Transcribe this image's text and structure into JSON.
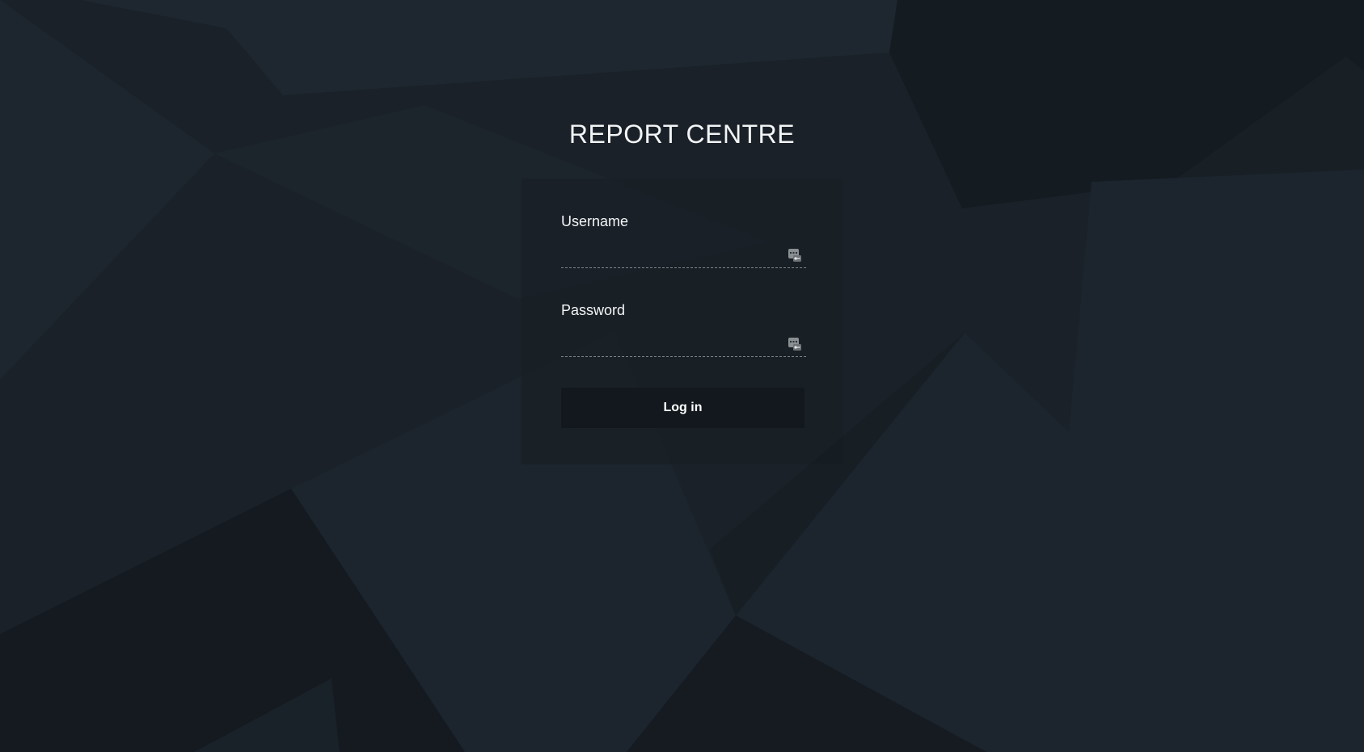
{
  "page": {
    "title": "REPORT CENTRE"
  },
  "form": {
    "username": {
      "label": "Username",
      "value": "",
      "icon": "password-manager-key-icon"
    },
    "password": {
      "label": "Password",
      "value": "",
      "icon": "password-manager-key-icon"
    },
    "submit_label": "Log in"
  },
  "colors": {
    "background": "#1a2128",
    "title_text": "#f2f4f5",
    "button_background": "#12181d",
    "input_underline": "#7b848c"
  }
}
